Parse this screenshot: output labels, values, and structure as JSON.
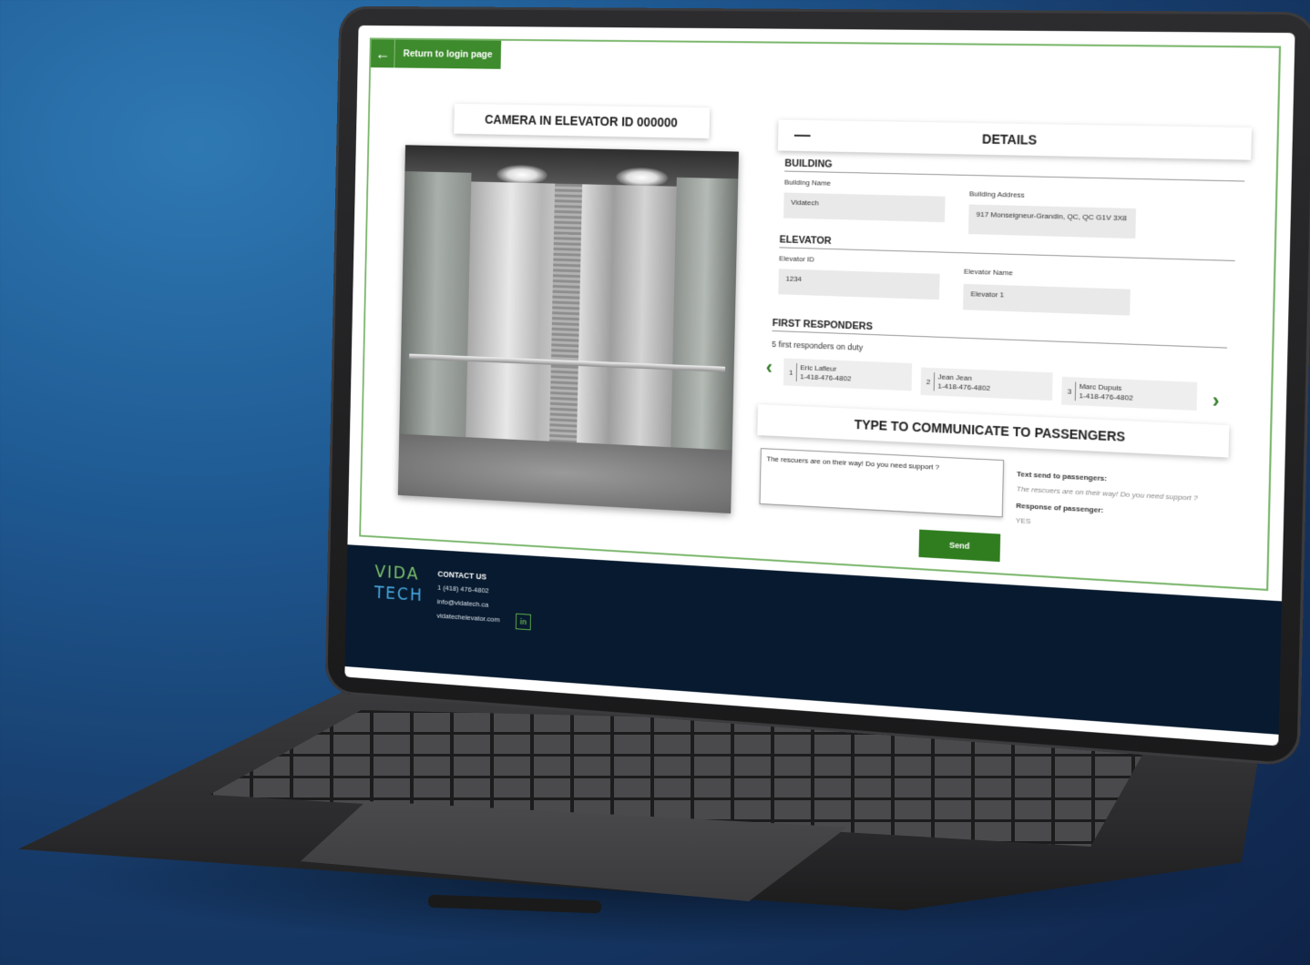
{
  "nav": {
    "back_label": "Return to login page"
  },
  "camera": {
    "title": "CAMERA IN ELEVATOR ID 000000"
  },
  "details": {
    "title": "DETAILS",
    "collapse_symbol": "—",
    "building": {
      "heading": "BUILDING",
      "name_label": "Building Name",
      "name_value": "Vidatech",
      "address_label": "Building Address",
      "address_value": "917 Monseigneur-Grandin, QC, QC G1V 3X8"
    },
    "elevator": {
      "heading": "ELEVATOR",
      "id_label": "Elevator ID",
      "id_value": "1234",
      "name_label": "Elevator Name",
      "name_value": "Elevator 1"
    },
    "responders": {
      "heading": "FIRST RESPONDERS",
      "summary": "5 first responders on duty",
      "items": [
        {
          "num": "1",
          "name": "Eric Lafleur",
          "phone": "1-418-476-4802"
        },
        {
          "num": "2",
          "name": "Jean Jean",
          "phone": "1-418-476-4802"
        },
        {
          "num": "3",
          "name": "Marc Dupuis",
          "phone": "1-418-476-4802"
        }
      ]
    }
  },
  "communication": {
    "title": "TYPE TO COMMUNICATE TO PASSENGERS",
    "input_value": "The rescuers are on their way! Do you need support ?",
    "sent_label": "Text send to passengers:",
    "sent_value": "The rescuers are on their way! Do you need support ?",
    "response_label": "Response of passenger:",
    "response_value": "YES",
    "send_label": "Send"
  },
  "footer": {
    "logo_top": "VIDA",
    "logo_bottom": "TECH",
    "contact_title": "CONTACT US",
    "phone": "1 (418) 476-4802",
    "email": "info@vidatech.ca",
    "website": "vidatechelevator.com",
    "linkedin": "in"
  },
  "colors": {
    "accent_green": "#3d8b2c",
    "footer_navy": "#081a2f",
    "background_blue": "#1f5a93"
  },
  "icons": {
    "back": "arrow-left-icon",
    "prev": "chevron-left-icon",
    "next": "chevron-right-icon",
    "social": "linkedin-icon"
  }
}
